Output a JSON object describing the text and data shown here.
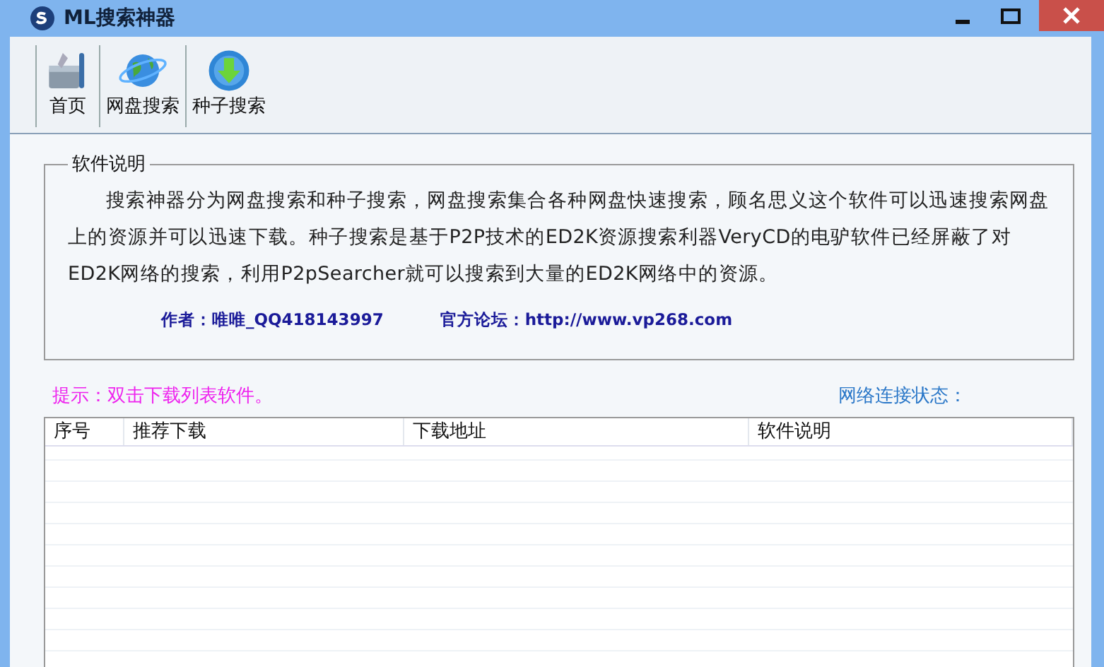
{
  "window": {
    "title": "ML搜索神器"
  },
  "toolbar": [
    {
      "label": "首页",
      "kind": "tools"
    },
    {
      "label": "网盘搜索",
      "kind": "globe"
    },
    {
      "label": "种子搜索",
      "kind": "download"
    }
  ],
  "about": {
    "title": "软件说明",
    "text": "搜索神器分为网盘搜索和种子搜索，网盘搜索集合各种网盘快速搜索，顾名思义这个软件可以迅速搜索网盘上的资源并可以迅速下载。种子搜索是基于P2P技术的ED2K资源搜索利器VeryCD的电驴软件已经屏蔽了对ED2K网络的搜索，利用P2pSearcher就可以搜索到大量的ED2K网络中的资源。",
    "author": "作者：唯唯_QQ418143997",
    "forum": "官方论坛：http://www.vp268.com"
  },
  "hint": "提示：双击下载列表软件。",
  "network_status": "网络连接状态：",
  "table": {
    "columns": [
      "序号",
      "推荐下载",
      "下载地址",
      "软件说明"
    ]
  }
}
